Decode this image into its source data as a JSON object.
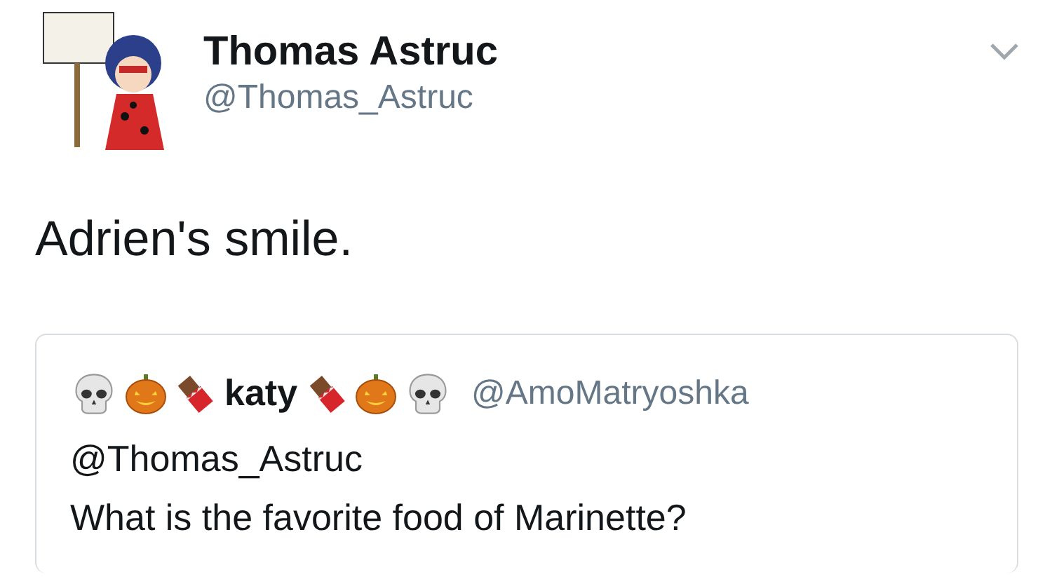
{
  "author": {
    "name": "Thomas Astruc",
    "handle": "@Thomas_Astruc"
  },
  "tweet_text": "Adrien's smile.",
  "quoted_tweet": {
    "emoji_before": [
      {
        "kind": "skull"
      },
      {
        "kind": "pumpkin"
      },
      {
        "kind": "chocolate"
      }
    ],
    "name": "katy",
    "emoji_after": [
      {
        "kind": "chocolate"
      },
      {
        "kind": "pumpkin"
      },
      {
        "kind": "skull"
      }
    ],
    "handle": "@AmoMatryoshka",
    "lines": [
      "@Thomas_Astruc",
      "What is the favorite food of Marinette?"
    ]
  }
}
